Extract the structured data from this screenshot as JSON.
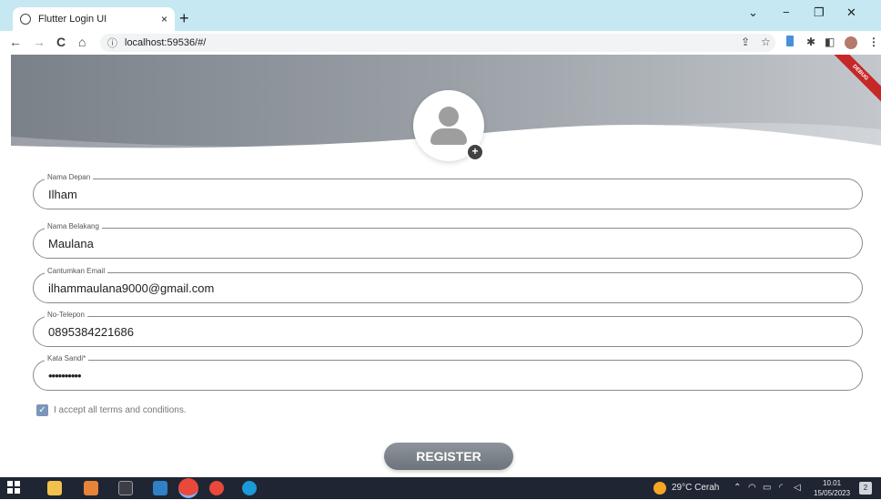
{
  "browser": {
    "tab_title": "Flutter Login UI",
    "tab_close": "×",
    "new_tab": "+",
    "url": "localhost:59536/#/",
    "info_icon": "ⓘ",
    "nav": {
      "back": "←",
      "forward": "→",
      "reload": "C",
      "home": "⌂"
    },
    "window": {
      "chevron": "⌄",
      "minimize": "−",
      "restore": "❐",
      "close": "✕"
    },
    "toolbar_icons": {
      "share": "⇪",
      "bookmark": "☆",
      "puzzle": "✱",
      "sidepanel": "◧",
      "menu": "⋮"
    }
  },
  "debug_banner": "DEBUG",
  "avatar": {
    "add_icon": "+"
  },
  "form": {
    "fields": [
      {
        "label": "Nama Depan",
        "value": "Ilham"
      },
      {
        "label": "Nama Belakang",
        "value": "Maulana"
      },
      {
        "label": "Cantumkan Email",
        "value": "ilhammaulana9000@gmail.com"
      },
      {
        "label": "No-Telepon",
        "value": "0895384221686"
      },
      {
        "label": "Kata Sandi*",
        "value": "••••••••••"
      }
    ],
    "terms_checked": true,
    "terms_check_glyph": "✓",
    "terms_label": "I accept all terms and conditions.",
    "register_label": "REGISTER"
  },
  "taskbar": {
    "weather": "29°C  Cerah",
    "time": "10.01",
    "date": "15/05/2023",
    "notification_count": "2"
  },
  "colors": {
    "accent": "#7a96b8",
    "header_start": "#7a8189",
    "header_end": "#c3c7cc",
    "button": "#6c737a",
    "debug": "#c62828"
  }
}
